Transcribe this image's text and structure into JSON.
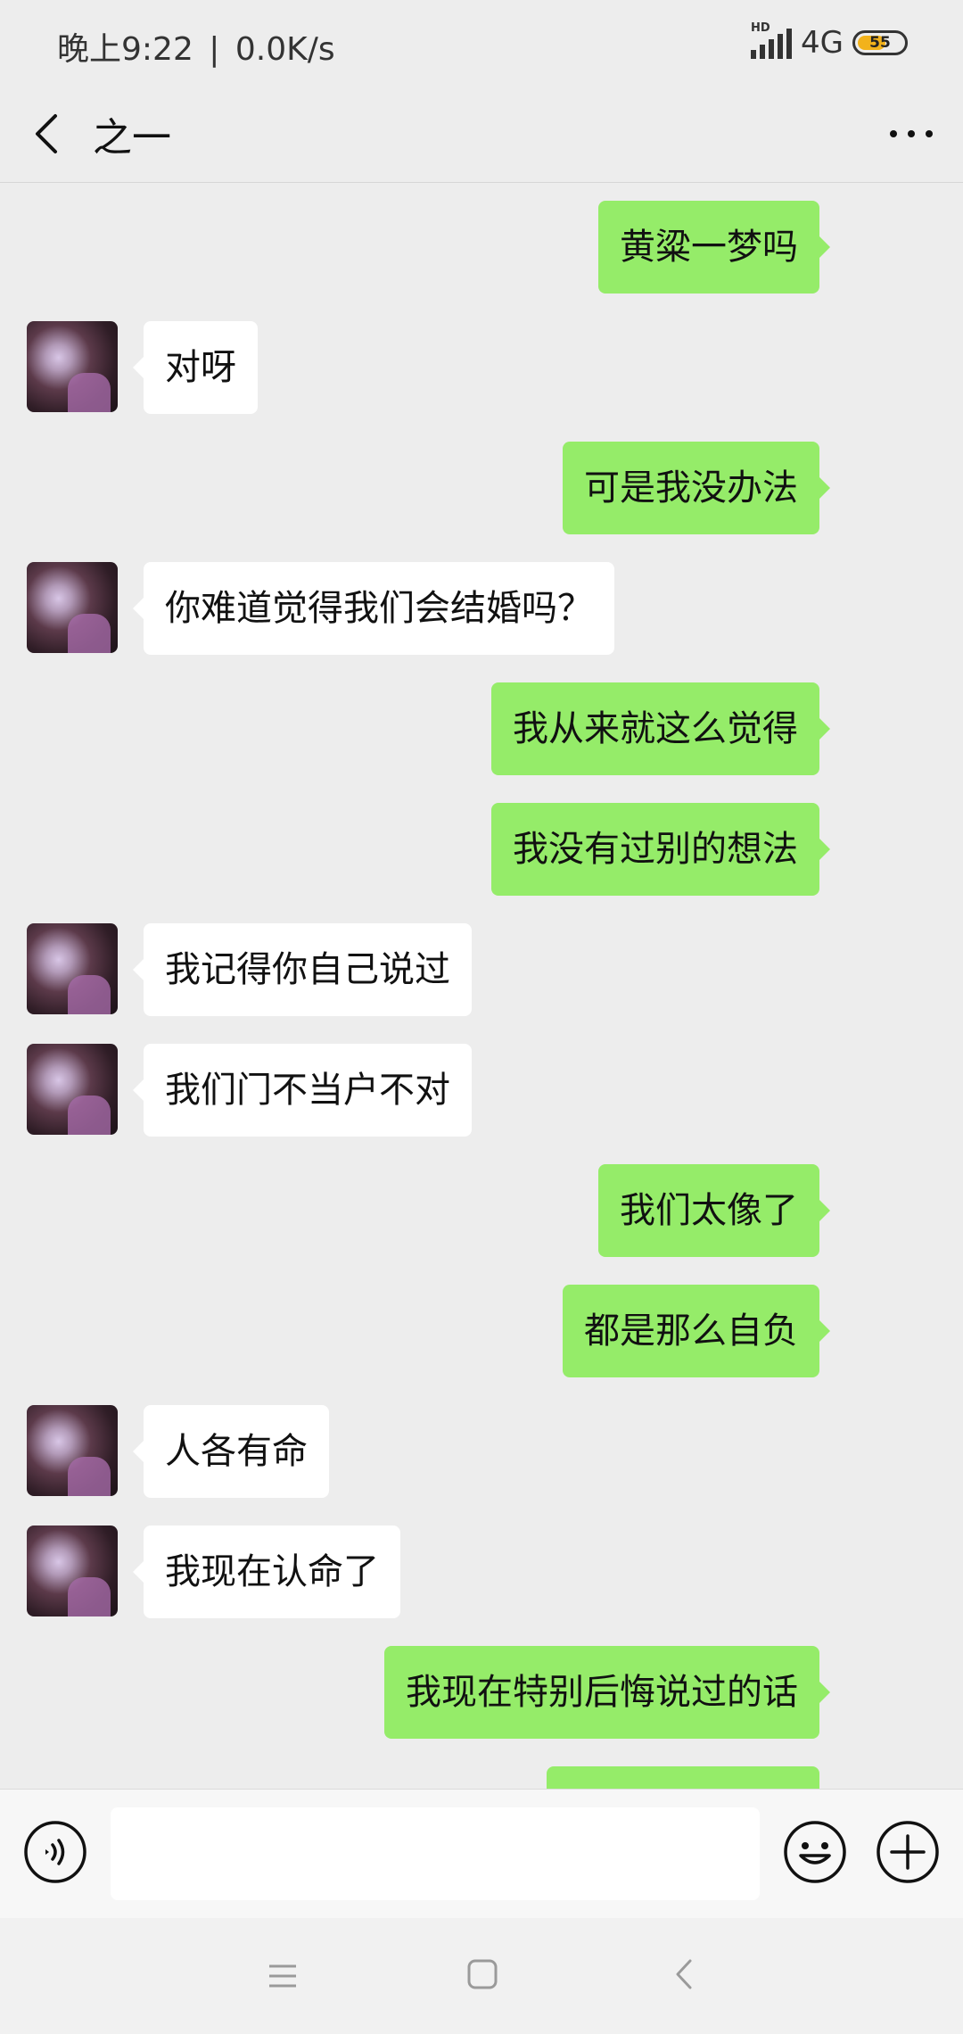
{
  "status_bar": {
    "time": "晚上9:22",
    "separator": "|",
    "speed": "0.0K/s",
    "hd": "HD",
    "network": "4G",
    "battery": "55"
  },
  "header": {
    "title": "之一"
  },
  "messages": [
    {
      "side": "right",
      "text": "黄粱一梦吗"
    },
    {
      "side": "left",
      "text": "对呀"
    },
    {
      "side": "right",
      "text": "可是我没办法"
    },
    {
      "side": "left",
      "text": "你难道觉得我们会结婚吗？"
    },
    {
      "side": "right",
      "text": "我从来就这么觉得"
    },
    {
      "side": "right",
      "text": "我没有过别的想法"
    },
    {
      "side": "left",
      "text": "我记得你自己说过"
    },
    {
      "side": "left",
      "text": "我们门不当户不对"
    },
    {
      "side": "right",
      "text": "我们太像了"
    },
    {
      "side": "right",
      "text": "都是那么自负"
    },
    {
      "side": "left",
      "text": "人各有命"
    },
    {
      "side": "left",
      "text": "我现在认命了"
    },
    {
      "side": "right",
      "text": "我现在特别后悔说过的话"
    },
    {
      "side": "right",
      "text": ""
    }
  ],
  "input": {
    "value": "",
    "placeholder": ""
  },
  "colors": {
    "background": "#ededed",
    "sent_bubble": "#95ec69",
    "received_bubble": "#ffffff",
    "battery": "#f2b21b"
  },
  "icons": [
    "back-icon",
    "more-icon",
    "voice-icon",
    "emoji-icon",
    "plus-icon",
    "nav-menu-icon",
    "nav-home-icon",
    "nav-back-icon"
  ]
}
